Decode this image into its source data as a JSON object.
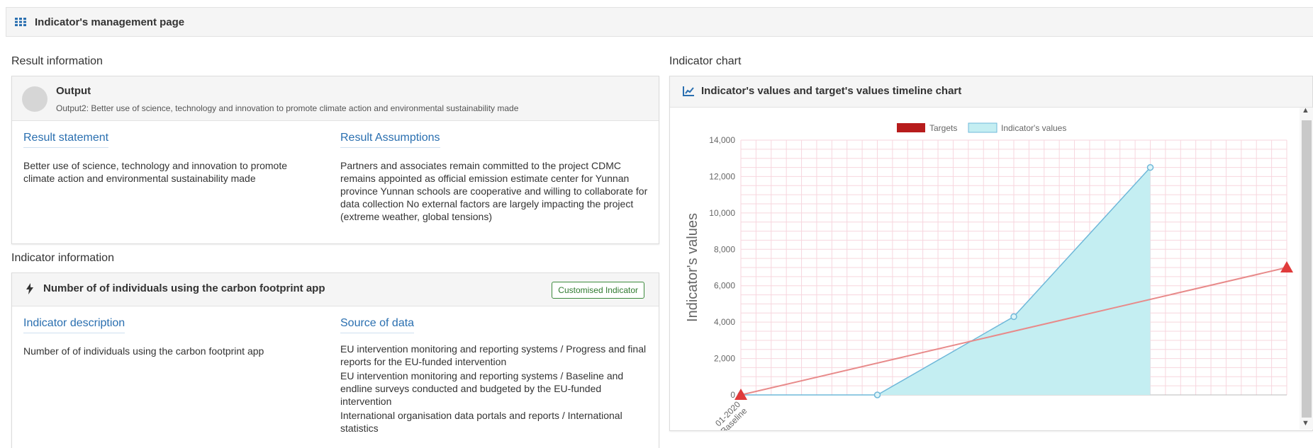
{
  "header": {
    "title": "Indicator's management page",
    "icon": "grid-icon"
  },
  "result": {
    "section_title": "Result information",
    "output": {
      "title": "Output",
      "subtitle": "Output2: Better use of science, technology and innovation to promote climate action and environmental sustainability made"
    },
    "statement_label": "Result statement",
    "statement_text": "Better use of science, technology and innovation to promote climate action and environmental sustainability made",
    "assumptions_label": "Result Assumptions",
    "assumptions_text": "Partners and associates remain committed to the project CDMC remains appointed as official emission estimate center for Yunnan province Yunnan schools are cooperative and willing to collaborate for data collection No external factors are largely impacting the project (extreme weather, global tensions)"
  },
  "indicator": {
    "section_title": "Indicator information",
    "title": "Number of of individuals using the carbon footprint app",
    "badge": "Customised Indicator",
    "description_label": "Indicator description",
    "description_text": "Number of of individuals using the carbon footprint app",
    "source_label": "Source of data",
    "sources": [
      "EU intervention monitoring and reporting systems / Progress and final reports for the EU-funded intervention",
      "EU intervention monitoring and reporting systems / Baseline and endline surveys conducted and budgeted by the EU-funded intervention",
      "International organisation data portals and reports / International statistics"
    ]
  },
  "chart_panel": {
    "section_title": "Indicator chart",
    "title": "Indicator's values and target's values timeline chart"
  },
  "colors": {
    "link": "#2a6fb0",
    "target": "#b71c1c",
    "target_line": "#e88a8a",
    "value_line": "#6fb8d9",
    "value_fill": "#c4eef2",
    "badge": "#3c8a3c"
  },
  "chart_data": {
    "type": "line",
    "ylabel": "Indicator's values",
    "ylim": [
      0,
      14000
    ],
    "yticks": [
      "0",
      "2,000",
      "4,000",
      "6,000",
      "8,000",
      "10,000",
      "12,000",
      "14,000"
    ],
    "xtick_label": [
      "01-2020",
      "Baseline"
    ],
    "legend": [
      "Targets",
      "Indicator's values"
    ],
    "legend_position": "top",
    "grid": true,
    "series": [
      {
        "name": "Targets",
        "points": [
          [
            0,
            0
          ],
          [
            20,
            7000
          ]
        ]
      },
      {
        "name": "Indicator's values",
        "points": [
          [
            0,
            0
          ],
          [
            5,
            0
          ],
          [
            10,
            4300
          ],
          [
            15,
            12500
          ]
        ]
      }
    ],
    "x_range": [
      0,
      20
    ]
  }
}
